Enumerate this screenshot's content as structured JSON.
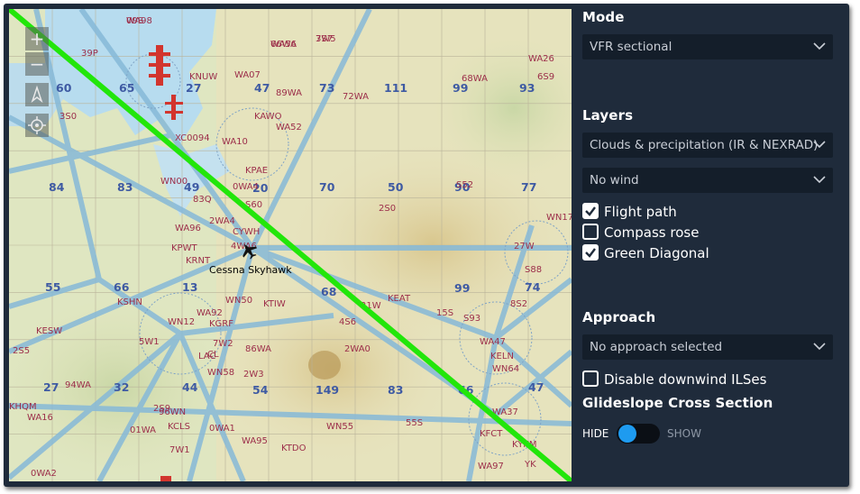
{
  "map": {
    "aircraft_label": "Cessna Skyhawk",
    "controls": {
      "zoom_in": "+",
      "zoom_out": "−",
      "north_glyph": "▲"
    },
    "diagonal_color": "#22e60a",
    "labels_blue": [
      "60",
      "65",
      "27",
      "47",
      "73",
      "111",
      "99",
      "93",
      "84",
      "83",
      "49",
      "70",
      "50",
      "90",
      "77",
      "55",
      "66",
      "13",
      "68",
      "99",
      "74",
      "27",
      "32",
      "44",
      "54",
      "149",
      "83",
      "66",
      "47",
      "20"
    ],
    "labels_red": [
      "WA98",
      "WA56",
      "3W5",
      "KNUW",
      "WA07",
      "89WA",
      "72WA",
      "KAWO",
      "WA52",
      "WA10",
      "KPAE",
      "WN00",
      "83Q",
      "0WA4",
      "S60",
      "WA96",
      "2WA4",
      "KPWT",
      "4WA6",
      "KRNT",
      "WA92",
      "WN50",
      "KTIW",
      "7W2",
      "86WA",
      "2W3",
      "KSHN",
      "WN12",
      "KGRF",
      "LAC",
      "5W1",
      "WN58",
      "96WN",
      "KCLS",
      "0WA1",
      "7W1",
      "KTDO",
      "WN55",
      "55S",
      "4S6",
      "2WA0",
      "21W",
      "15S",
      "S93",
      "WA47",
      "KELN",
      "WN64",
      "WA37",
      "KFCT",
      "KYKM",
      "YK",
      "WA97",
      "68WA",
      "WA26",
      "6S9",
      "S52",
      "2S0",
      "27W",
      "S88",
      "8S2",
      "KEAT",
      "WN17",
      "KESW",
      "2S5",
      "94WA",
      "KHQM",
      "WA16",
      "2S9",
      "01WA",
      "WA95",
      "0WA2",
      "39P",
      "3S0",
      "XC0094",
      "CYWH",
      "CL",
      "09S",
      "66WA",
      "7S7"
    ],
    "grid": {
      "cols": 13,
      "rows": 10
    }
  },
  "panel": {
    "mode": {
      "title": "Mode",
      "value": "VFR sectional"
    },
    "layers": {
      "title": "Layers",
      "clouds": "Clouds & precipitation (IR & NEXRAD)",
      "wind": "No wind",
      "checkboxes": [
        {
          "label": "Flight path",
          "checked": true
        },
        {
          "label": "Compass rose",
          "checked": false
        },
        {
          "label": "Green Diagonal",
          "checked": true
        }
      ]
    },
    "approach": {
      "title": "Approach",
      "value": "No approach selected",
      "disable_downwind": {
        "label": "Disable downwind ILSes",
        "checked": false
      },
      "glideslope_title": "Glideslope Cross Section",
      "hide_label": "HIDE",
      "show_label": "SHOW",
      "glideslope_shown": false
    }
  },
  "colors": {
    "panel_bg": "#1f2b3b",
    "select_bg": "#141e2a",
    "toggle_knob": "#1e9bf0",
    "diagonal": "#22e60a",
    "map_blue": "#86b9d8"
  }
}
